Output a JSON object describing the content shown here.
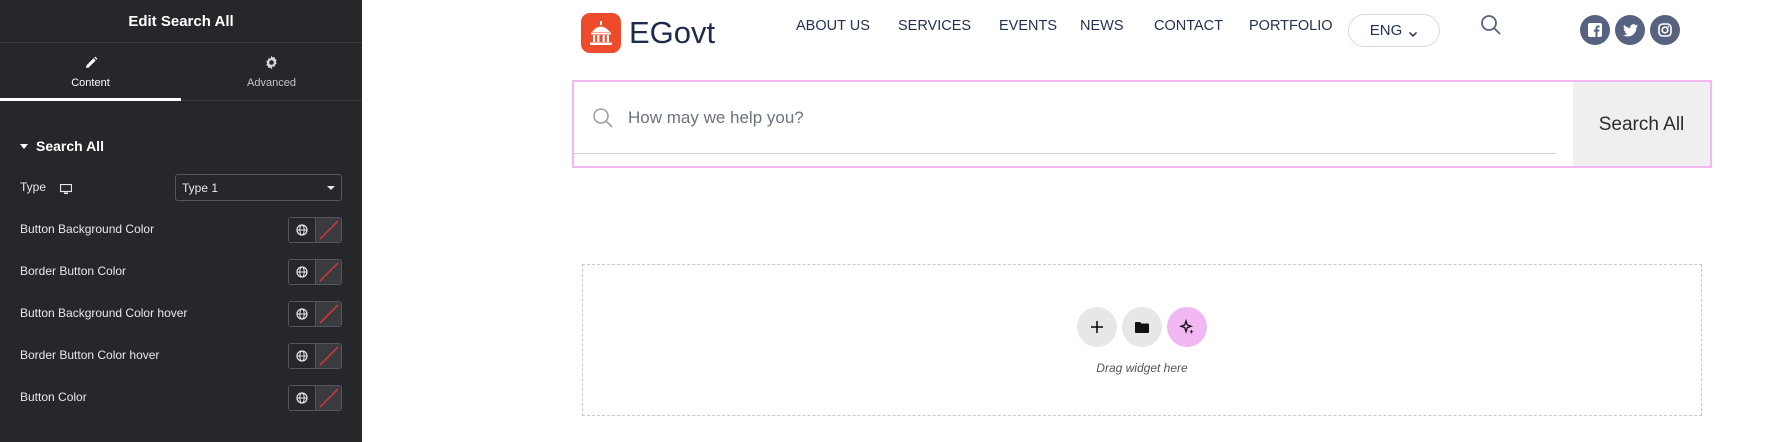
{
  "panel": {
    "title": "Edit Search All",
    "tabs": [
      {
        "label": "Content",
        "icon": "pencil-icon",
        "active": true
      },
      {
        "label": "Advanced",
        "icon": "gear-icon",
        "active": false
      }
    ],
    "section": {
      "title": "Search All",
      "expanded": true
    },
    "type_control": {
      "label": "Type",
      "icon": "monitor-icon",
      "value": "Type 1"
    },
    "color_controls": [
      {
        "label": "Button Background Color"
      },
      {
        "label": "Border Button Color"
      },
      {
        "label": "Button Background Color hover"
      },
      {
        "label": "Border Button Color hover"
      },
      {
        "label": "Button Color"
      }
    ]
  },
  "site": {
    "logo_text": "EGovt",
    "logo_icon": "capitol-building-icon",
    "nav": [
      "ABOUT US",
      "SERVICES",
      "EVENTS",
      "NEWS",
      "CONTACT",
      "PORTFOLIO"
    ],
    "language": "ENG",
    "socials": [
      "facebook-icon",
      "twitter-icon",
      "instagram-icon"
    ]
  },
  "search": {
    "placeholder": "How may we help you?",
    "button_label": "Search All"
  },
  "drop_zone": {
    "hint": "Drag widget here"
  },
  "colors": {
    "panel_bg": "#26272b",
    "accent_pink": "#f1b8f3",
    "logo_red": "#ee4a2c",
    "nav_text": "#243153",
    "social_bg": "#56627f"
  }
}
